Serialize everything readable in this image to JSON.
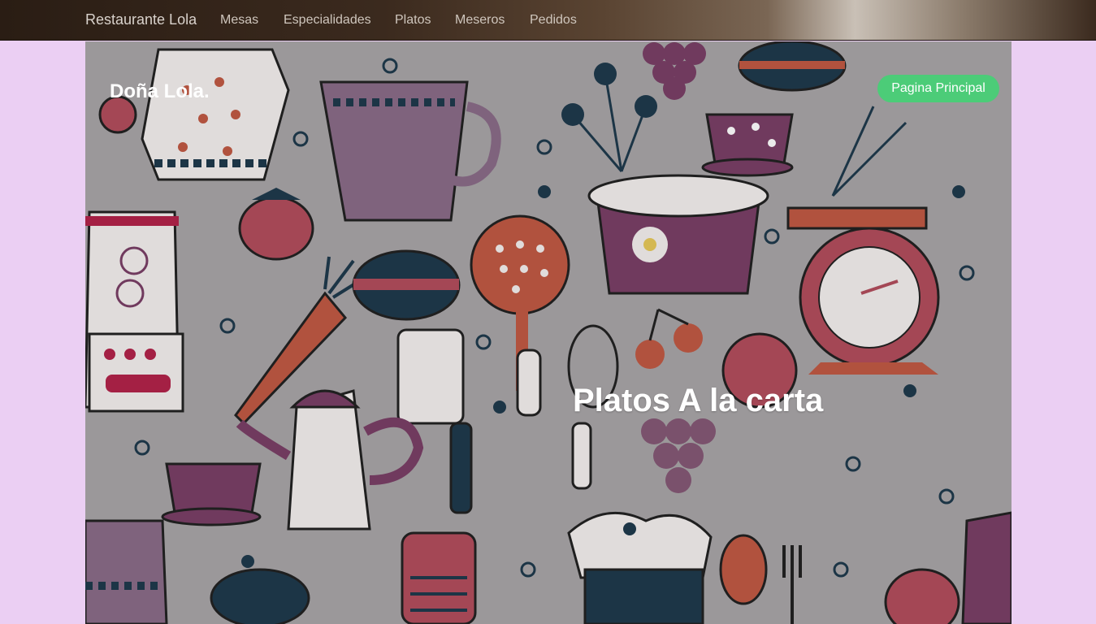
{
  "navbar": {
    "brand": "Restaurante Lola",
    "links": [
      {
        "label": "Mesas"
      },
      {
        "label": "Especialidades"
      },
      {
        "label": "Platos"
      },
      {
        "label": "Meseros"
      },
      {
        "label": "Pedidos"
      }
    ]
  },
  "hero": {
    "site_title": "Doña Lola.",
    "home_button": "Pagina Principal",
    "heading": "Platos A la carta"
  },
  "colors": {
    "page_background": "#ebcff3",
    "button_green": "#4ccc78",
    "pattern_plum": "#7a3f66",
    "pattern_rust": "#c05a44",
    "pattern_navy": "#1f3a4d"
  }
}
